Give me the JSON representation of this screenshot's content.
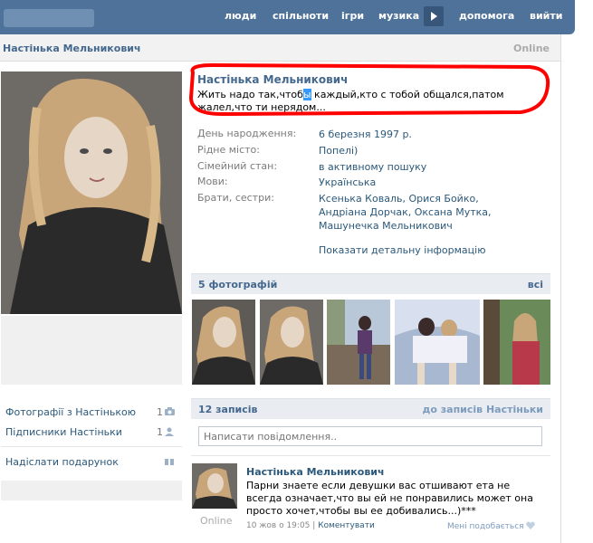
{
  "topnav": {
    "items": [
      "люди",
      "спільноти",
      "ігри",
      "музика",
      "допомога",
      "вийти"
    ]
  },
  "header": {
    "name": "Настінька Мельникович",
    "online": "Online"
  },
  "profile": {
    "name": "Настінька Мельникович",
    "status_before": "Жить надо так,чтоб",
    "status_selected": "ы",
    "status_after": " каждый,кто с тобой общался,патом жалел,что ти нерядом...",
    "info": [
      {
        "label": "День народження:",
        "value": "6 березня 1997 р."
      },
      {
        "label": "Рідне місто:",
        "value": "Попелі)"
      },
      {
        "label": "Сімейний стан:",
        "value": "в активному пошуку"
      },
      {
        "label": "Мови:",
        "value": "Українська"
      },
      {
        "label": "Брати, сестри:",
        "value": "Ксенька Коваль, Орися Бойко, Андріана Дорчак, Оксана Мутка, Машунечка Мельникович"
      }
    ],
    "more_info": "Показати детальну інформацію"
  },
  "sidebar": {
    "photos_with": "Фотографії з Настінькою",
    "photos_count": "1",
    "followers": "Підписники Настіньки",
    "followers_count": "1",
    "send_gift": "Надіслати подарунок"
  },
  "photos": {
    "title": "5 фотографій",
    "all": "всі"
  },
  "wall": {
    "title": "12 записів",
    "to_posts": "до записів Настіньки",
    "input_placeholder": "Написати повідомлення..",
    "post": {
      "author": "Настінька Мельникович",
      "text": "Парни знаете если девушки вас отшивают ета не всегда означает,что вы ей не понравились может она просто хочет,чтобы вы ее добивались...)***",
      "online": "Online",
      "date": "10 жов о 19:05",
      "separator": "|",
      "comment": "Коментувати",
      "like": "Мені подобається"
    }
  },
  "colors": {
    "topbar": "#4e729a",
    "link": "#2b587a",
    "accent_red": "#ff0000"
  }
}
